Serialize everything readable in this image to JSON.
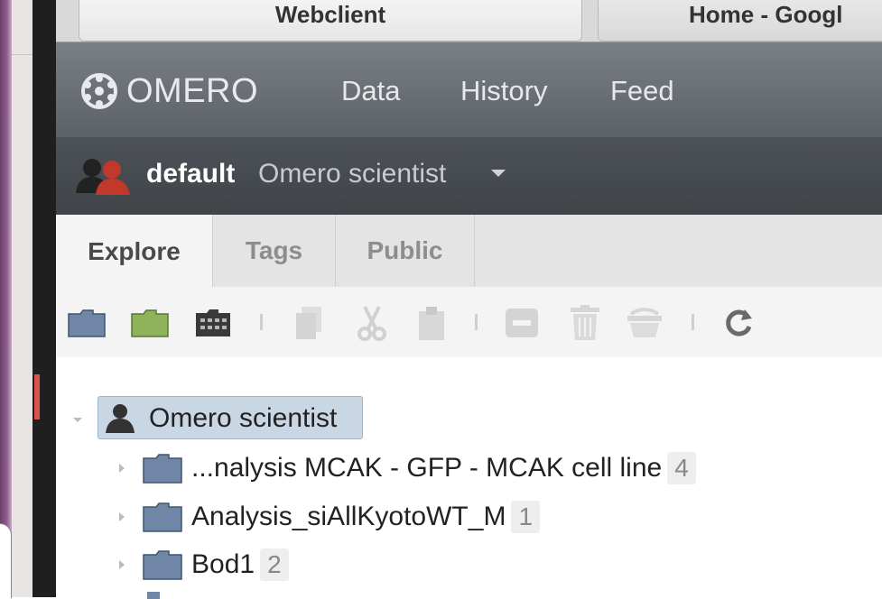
{
  "browser": {
    "tabs": [
      {
        "label": "Webclient"
      },
      {
        "label": "Home - Googl"
      }
    ]
  },
  "app": {
    "brand": "OMERO",
    "nav": [
      {
        "label": "Data"
      },
      {
        "label": "History"
      },
      {
        "label": "Feed"
      }
    ]
  },
  "user": {
    "group": "default",
    "name": "Omero scientist"
  },
  "panel_tabs": [
    {
      "label": "Explore",
      "active": true
    },
    {
      "label": "Tags"
    },
    {
      "label": "Public"
    }
  ],
  "toolbar": {
    "icons": [
      "new-project-icon",
      "new-dataset-icon",
      "new-screen-icon",
      "copy-icon",
      "cut-icon",
      "paste-icon",
      "remove-icon",
      "delete-icon",
      "empty-basket-icon",
      "refresh-icon"
    ]
  },
  "tree": {
    "root": {
      "label": "Omero scientist"
    },
    "projects": [
      {
        "label": "...nalysis MCAK - GFP - MCAK cell line",
        "count": "4"
      },
      {
        "label": "Analysis_siAllKyotoWT_M",
        "count": "1"
      },
      {
        "label": "Bod1",
        "count": "2"
      }
    ]
  },
  "colors": {
    "nav_bg": "#6b7077",
    "userbar_bg": "#464b51",
    "selection_bg": "#c9d6e4",
    "project_folder": "#6f86a6",
    "dataset_folder": "#8fb35a"
  }
}
